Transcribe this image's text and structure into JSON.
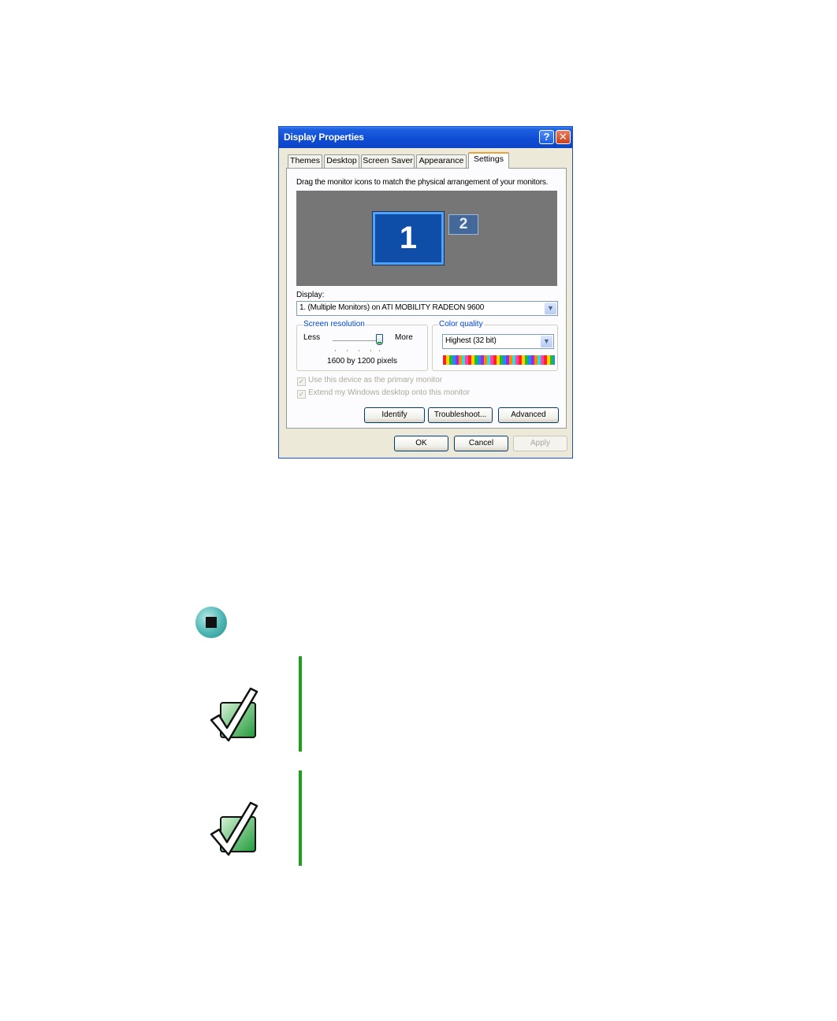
{
  "dialog": {
    "title": "Display Properties",
    "help_button": "?",
    "close_button": "✕",
    "tabs": [
      {
        "label": "Themes"
      },
      {
        "label": "Desktop"
      },
      {
        "label": "Screen Saver"
      },
      {
        "label": "Appearance"
      },
      {
        "label": "Settings",
        "active": true
      }
    ],
    "instruction": "Drag the monitor icons to match the physical arrangement of your monitors.",
    "monitors": [
      {
        "label": "1",
        "selected": true
      },
      {
        "label": "2",
        "selected": false
      }
    ],
    "display_label": "Display:",
    "display_value": "1. (Multiple Monitors) on ATI MOBILITY RADEON 9600",
    "resolution": {
      "group_label": "Screen resolution",
      "less_label": "Less",
      "more_label": "More",
      "value_text": "1600 by 1200 pixels",
      "slider_level": 1.0
    },
    "color_quality": {
      "group_label": "Color quality",
      "value": "Highest (32 bit)"
    },
    "checkboxes": [
      {
        "label": "Use this device as the primary monitor",
        "checked": true,
        "disabled": true
      },
      {
        "label": "Extend my Windows desktop onto this monitor",
        "checked": true,
        "disabled": true
      }
    ],
    "action_buttons": {
      "identify": "Identify",
      "troubleshoot": "Troubleshoot...",
      "advanced": "Advanced"
    },
    "footer_buttons": {
      "ok": "OK",
      "cancel": "Cancel",
      "apply": "Apply"
    },
    "colors": {
      "titlebar": "#0f4dd6",
      "selected_monitor": "#0f4ea8",
      "monitor_area": "#767676"
    }
  },
  "document": {
    "icons": [
      "end-of-procedure-icon",
      "important-checkmark-icon",
      "important-checkmark-icon"
    ],
    "colors": {
      "rule": "#1aa21a",
      "marker": "#4bb5b2"
    }
  }
}
